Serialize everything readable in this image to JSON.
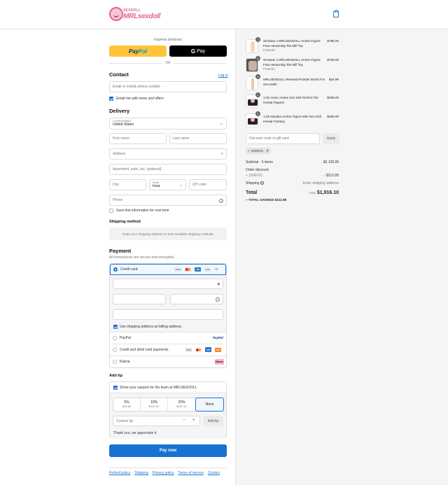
{
  "header": {
    "logo_small": "SEXDOLL",
    "logo_text": "MRLsexdoll",
    "cart_icon": "shopping-bag-icon"
  },
  "express": {
    "label": "Express checkout",
    "paypal_a": "Pay",
    "paypal_b": "Pal",
    "gpay_g": "G",
    "gpay_label": "Pay",
    "or": "OR"
  },
  "contact": {
    "title": "Contact",
    "login": "Log in",
    "email_placeholder": "Email or mobile phone number",
    "news_label": "Email me with news and offers"
  },
  "delivery": {
    "title": "Delivery",
    "country_label": "Country/Region",
    "country_value": "United States",
    "first_name": "First name",
    "last_name": "Last name",
    "address": "Address",
    "apartment": "Apartment, suite, etc. (optional)",
    "city": "City",
    "state_label": "State",
    "state_value": "Iowa",
    "zip": "ZIP code",
    "phone": "Phone",
    "save_info": "Save this information for next time"
  },
  "shipping": {
    "title": "Shipping method",
    "notice": "Enter your shipping address to view available shipping methods"
  },
  "payment": {
    "title": "Payment",
    "subtitle": "All transactions are secure and encrypted.",
    "credit_card": "Credit card",
    "more_cards": "+3",
    "billing_label": "Use shipping address as billing address",
    "paypal": "PayPal",
    "paypal_logo": "PayPal",
    "credit_debit": "Credit and debit card payments",
    "klarna": "Klarna",
    "klarna_logo": "Klarna."
  },
  "tip": {
    "title": "Add tip",
    "support_label": "Show your support for the team at MRLSEXDOLL",
    "options": [
      {
        "pct": "5%",
        "amt": "$95.80"
      },
      {
        "pct": "10%",
        "amt": "$191.61"
      },
      {
        "pct": "15%",
        "amt": "$287.42"
      },
      {
        "pct": "None",
        "amt": ""
      }
    ],
    "custom_placeholder": "Custom tip",
    "add_button": "Add tip",
    "thanks": "Thank you, we appreciate it."
  },
  "pay_now": "Pay now",
  "footer": [
    "Refund policy",
    "Shipping",
    "Privacy policy",
    "Terms of service",
    "Contact"
  ],
  "cart": {
    "items": [
      {
        "qty": "1",
        "name": "Sinsisan x MRLSEXDOLL Anime Figure: Futa Hentai Big Tits Milf Toy",
        "variant": "Futanari",
        "price": "$798.00"
      },
      {
        "qty": "1",
        "name": "Sinsisan x MRLSEXDOLL Anime Figure: Futa Hentai Big Tits Milf Toy",
        "variant": "Futanari",
        "price": "$798.00"
      },
      {
        "qty": "1",
        "name": "MRLSEXDOLL Renewal Powder Brush For Sex Dolls",
        "variant": "",
        "price": "$16.99"
      },
      {
        "qty": "1",
        "name": "1:26 Anna: Anime Sex Doll Perfect Tits Hentai Figures",
        "variant": "",
        "price": "$258.00"
      },
      {
        "qty": "1",
        "name": "1:25 Nanako:Anime Figure Mini Sex Doll Hentai Fantasy",
        "variant": "",
        "price": "$258.00"
      }
    ],
    "discount_placeholder": "Discount code or gift card",
    "apply": "Apply",
    "code": "10VEVU",
    "subtotal_label": "Subtotal · 5 items",
    "subtotal": "$2,128.99",
    "order_discount": "Order discount",
    "discount_code": "10VEVU",
    "discount_amount": "- $212.89",
    "shipping_label": "Shipping",
    "shipping_value": "Enter shipping address",
    "total_label": "Total",
    "currency": "USD",
    "total": "$1,916.10",
    "savings_label": "TOTAL SAVINGS",
    "savings": "$212.89"
  },
  "colors": {
    "accent": "#1773d1",
    "paypal_yellow": "#ffc439",
    "logo_pink": "#e0668f"
  }
}
